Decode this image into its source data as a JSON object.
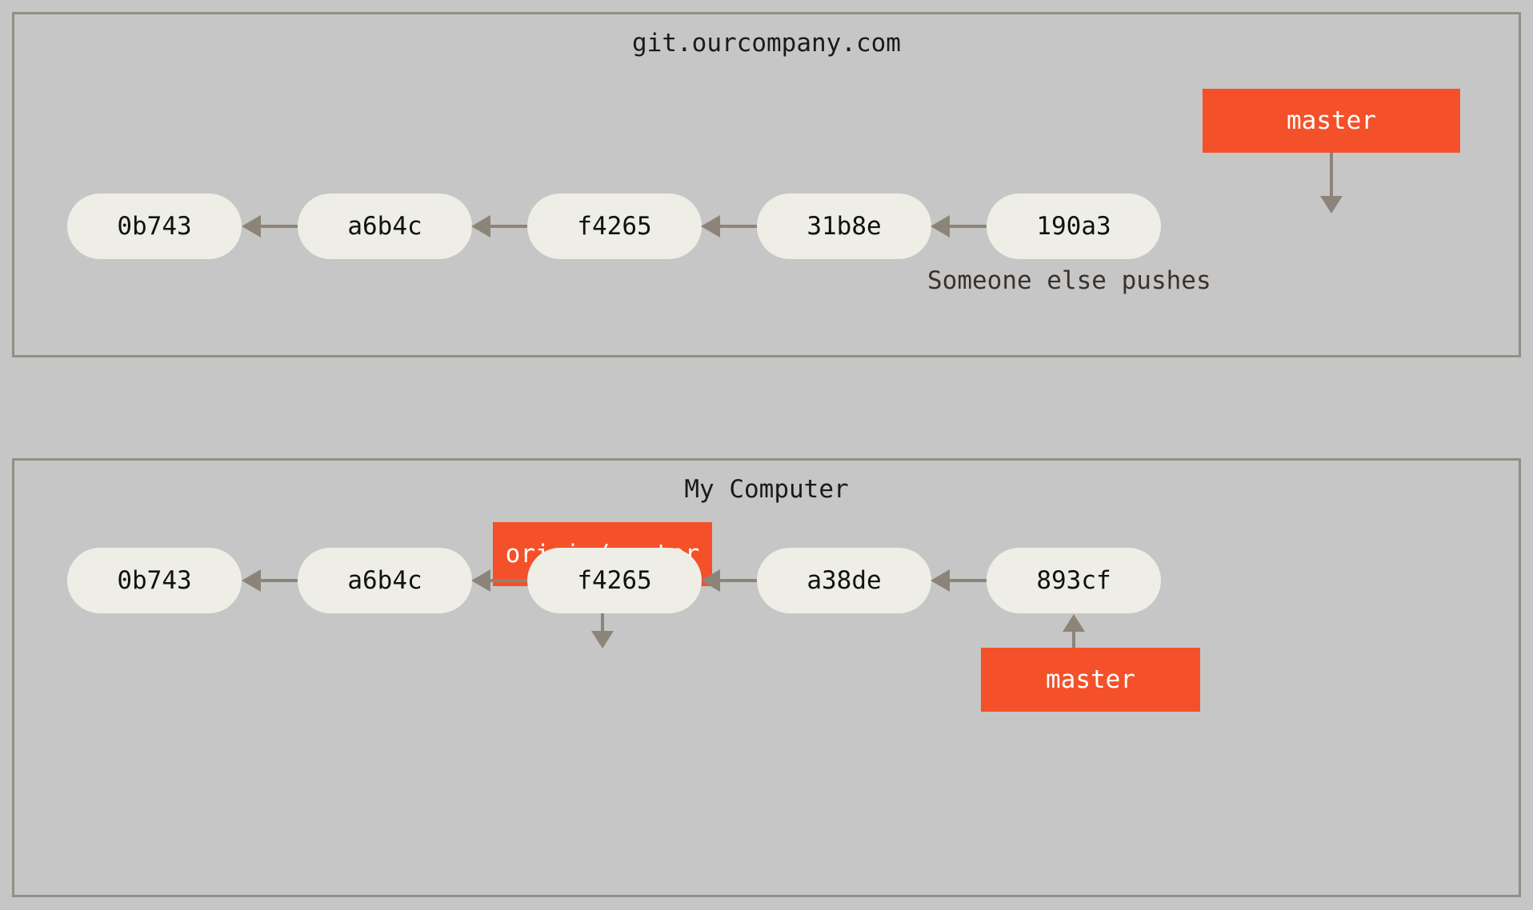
{
  "diagram": {
    "type": "git-history-divergence",
    "background_color": "#c6c6c6",
    "node_color": "#eeeee6",
    "ref_color": "#f4512a",
    "arrow_color": "#8d8479",
    "border_color": "#938e85"
  },
  "server_panel": {
    "title": "git.ourcompany.com",
    "caption": "Someone else pushes",
    "commits": [
      {
        "id": "0b743"
      },
      {
        "id": "a6b4c"
      },
      {
        "id": "f4265"
      },
      {
        "id": "31b8e"
      },
      {
        "id": "190a3"
      }
    ],
    "refs": [
      {
        "label": "master",
        "points_to": "190a3",
        "direction": "down"
      }
    ]
  },
  "local_panel": {
    "title": "My Computer",
    "commits": [
      {
        "id": "0b743"
      },
      {
        "id": "a6b4c"
      },
      {
        "id": "f4265"
      },
      {
        "id": "a38de"
      },
      {
        "id": "893cf"
      }
    ],
    "refs": [
      {
        "label": "origin/master",
        "points_to": "f4265",
        "direction": "down"
      },
      {
        "label": "master",
        "points_to": "893cf",
        "direction": "up"
      }
    ]
  }
}
